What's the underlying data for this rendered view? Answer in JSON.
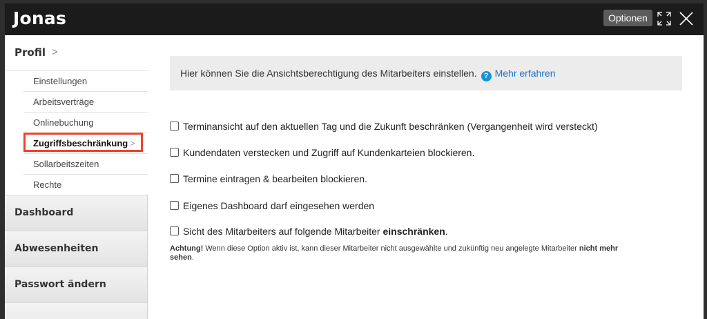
{
  "header": {
    "title": "Jonas",
    "options_label": "Optionen",
    "expand_icon": "expand-icon",
    "close_icon": "close-icon"
  },
  "sidebar": {
    "profil_label": "Profil",
    "profil_chevron": ">",
    "subitems": [
      {
        "label": "Einstellungen"
      },
      {
        "label": "Arbeitsverträge"
      },
      {
        "label": "Onlinebuchung"
      },
      {
        "label": "Zugriffsbeschränkung",
        "chevron": ">",
        "active": true
      },
      {
        "label": "Sollarbeitszeiten"
      },
      {
        "label": "Rechte"
      }
    ],
    "nav": [
      {
        "label": "Dashboard"
      },
      {
        "label": "Abwesenheiten"
      },
      {
        "label": "Passwort ändern"
      }
    ]
  },
  "main": {
    "info_text": "Hier können Sie die Ansichtsberechtigung des Mitarbeiters einstellen.",
    "help_glyph": "?",
    "more_link": "Mehr erfahren",
    "options": [
      {
        "label": "Terminansicht auf den aktuellen Tag und die Zukunft beschränken (Vergangenheit wird versteckt)",
        "checked": false
      },
      {
        "label": "Kundendaten verstecken und Zugriff auf Kundenkarteien blockieren.",
        "checked": false
      },
      {
        "label": "Termine eintragen & bearbeiten blockieren.",
        "checked": false
      },
      {
        "label": "Eigenes Dashboard darf eingesehen werden",
        "checked": false
      }
    ],
    "restrict_option": {
      "prefix": "Sicht des Mitarbeiters auf folgende Mitarbeiter ",
      "bold": "einschränken",
      "suffix": ".",
      "checked": false
    },
    "note": {
      "bold1": "Achtung!",
      "text": " Wenn diese Option aktiv ist, kann dieser Mitarbeiter nicht ausgewählte und zukünftig neu angelegte Mitarbeiter ",
      "bold2": "nicht mehr sehen",
      "suffix": "."
    }
  },
  "colors": {
    "titlebar": "#1b1b1b",
    "highlight": "#f0412a",
    "link": "#1a73c7",
    "help_icon": "#1793d1"
  }
}
